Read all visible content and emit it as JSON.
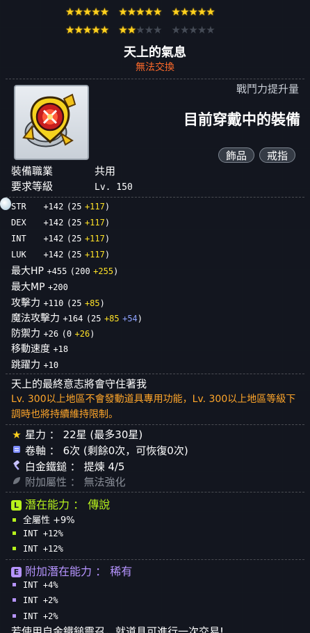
{
  "stars": {
    "row1": [
      5,
      5,
      5
    ],
    "row2": [
      {
        "on": 5,
        "off": 0
      },
      {
        "on": 2,
        "off": 3
      },
      {
        "on": 0,
        "off": 5
      }
    ],
    "filled_total": 22,
    "max_total": 30,
    "star_glyph": "★"
  },
  "item": {
    "name": "天上的氣息",
    "trade_note": "無法交換",
    "combat_power_label": "戰鬥力提升量",
    "equipped_label": "目前穿戴中的裝備",
    "tags": [
      "飾品",
      "戒指"
    ]
  },
  "requirements": {
    "job_label": "裝備職業",
    "job_value": "共用",
    "level_label": "要求等級",
    "level_value": "Lv. 150"
  },
  "stats": [
    {
      "name": "STR",
      "total": "+142",
      "base": "(25",
      "plus1": "+117",
      "plus2": "",
      "close": ")"
    },
    {
      "name": "DEX",
      "total": "+142",
      "base": "(25",
      "plus1": "+117",
      "plus2": "",
      "close": ")"
    },
    {
      "name": "INT",
      "total": "+142",
      "base": "(25",
      "plus1": "+117",
      "plus2": "",
      "close": ")"
    },
    {
      "name": "LUK",
      "total": "+142",
      "base": "(25",
      "plus1": "+117",
      "plus2": "",
      "close": ")"
    },
    {
      "name": "最大HP",
      "total": "+455",
      "base": "(200",
      "plus1": "+255",
      "plus2": "",
      "close": ")"
    },
    {
      "name": "最大MP",
      "total": "+200",
      "base": "",
      "plus1": "",
      "plus2": "",
      "close": ""
    },
    {
      "name": "攻擊力",
      "total": "+110",
      "base": "(25",
      "plus1": "+85",
      "plus2": "",
      "close": ")"
    },
    {
      "name": "魔法攻擊力",
      "total": "+164",
      "base": "(25",
      "plus1": "+85",
      "plus2": "+54",
      "close": ")"
    },
    {
      "name": "防禦力",
      "total": "+26",
      "base": "(0",
      "plus1": "+26",
      "plus2": "",
      "close": ")"
    },
    {
      "name": "移動速度",
      "total": "+18",
      "base": "",
      "plus1": "",
      "plus2": "",
      "close": ""
    },
    {
      "name": "跳躍力",
      "total": "+10",
      "base": "",
      "plus1": "",
      "plus2": "",
      "close": ""
    }
  ],
  "description": {
    "line1": "天上的最終意志將會守住著我",
    "line2": "Lv. 300以上地區不會發動道具專用功能，Lv. 300以上地區等級下調時也將持續維持限制。"
  },
  "info": {
    "starforce_label": "星力",
    "starforce_value": "22星 (最多30星)",
    "scroll_label": "卷軸",
    "scroll_value": "6次 (剩餘0次，可恢復0次)",
    "platinum_label": "白金鐵鎚",
    "platinum_value": "提煉 4/5",
    "extra_label": "附加屬性",
    "extra_value": "無法強化"
  },
  "potential": {
    "badge": "L",
    "label": "潛在能力",
    "grade": "傳說",
    "color": "#b7f21c",
    "lines": [
      "全屬性 +9%",
      "INT +12%",
      "INT +12%"
    ]
  },
  "additional_potential": {
    "badge": "E",
    "label": "附加潛在能力",
    "grade": "稀有",
    "color": "#b694ff",
    "lines": [
      "INT +4%",
      "INT +2%",
      "INT +2%"
    ]
  },
  "cutoff_text": "若使用自金鐵鎚靈召，就道具可進行一次交易!",
  "colors": {
    "star_on": "#ffd21f",
    "star_off": "#444a55",
    "trade_note": "#ff6a2a",
    "bonus_yellow": "#ffe227",
    "bonus_blue": "#8fa3ff",
    "description_orange": "#ffa62a"
  },
  "icons": [
    "star-icon",
    "scroll-icon",
    "hammer-icon",
    "leaf-icon",
    "ring-item-icon"
  ]
}
